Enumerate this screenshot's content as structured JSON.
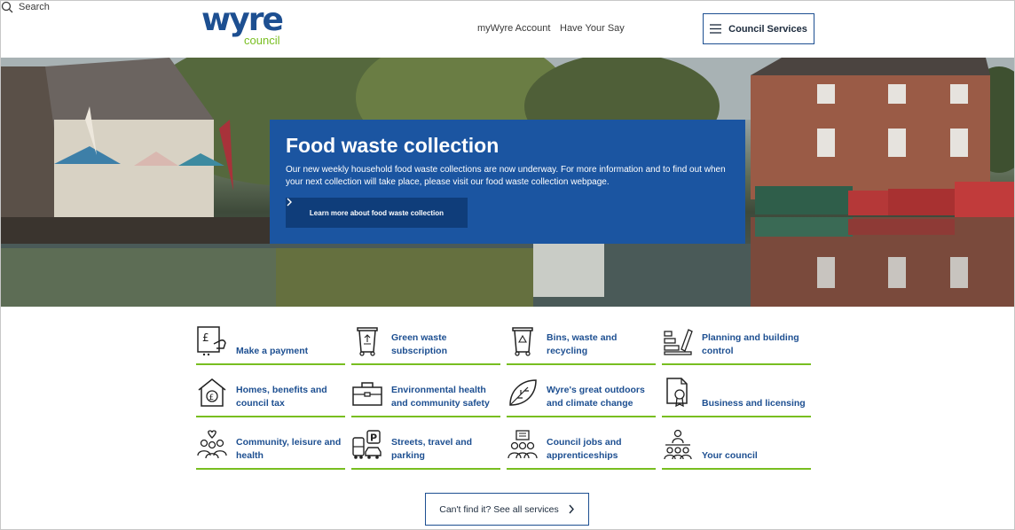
{
  "header": {
    "logo_main": "wyre",
    "logo_sub": "council",
    "nav_account": "myWyre Account",
    "nav_say": "Have Your Say",
    "nav_search": "Search",
    "services_button": "Council Services"
  },
  "hero": {
    "title": "Food waste collection",
    "text": "Our new weekly household food waste collections are now underway. For more information and to find out when your next collection will take place, please visit our food waste collection webpage.",
    "button": "Learn more about food waste collection"
  },
  "services": [
    {
      "label": "Make a payment",
      "icon": "payment-icon"
    },
    {
      "label": "Green waste subscription",
      "icon": "green-bin-icon"
    },
    {
      "label": "Bins, waste and recycling",
      "icon": "recycling-bin-icon"
    },
    {
      "label": "Planning and building control",
      "icon": "planning-icon"
    },
    {
      "label": "Homes, benefits and council tax",
      "icon": "home-pound-icon"
    },
    {
      "label": "Environmental health and community safety",
      "icon": "toolbox-icon"
    },
    {
      "label": "Wyre's great outdoors and climate change",
      "icon": "leaf-icon"
    },
    {
      "label": "Business and licensing",
      "icon": "certificate-icon"
    },
    {
      "label": "Community, leisure and health",
      "icon": "community-icon"
    },
    {
      "label": "Streets, travel and parking",
      "icon": "parking-icon"
    },
    {
      "label": "Council jobs and apprenticeships",
      "icon": "jobs-icon"
    },
    {
      "label": "Your council",
      "icon": "council-icon"
    }
  ],
  "footer_button": "Can't find it? See all services",
  "colors": {
    "brand_blue": "#1d4f91",
    "hero_blue": "#1b55a1",
    "accent_green": "#78be20"
  }
}
